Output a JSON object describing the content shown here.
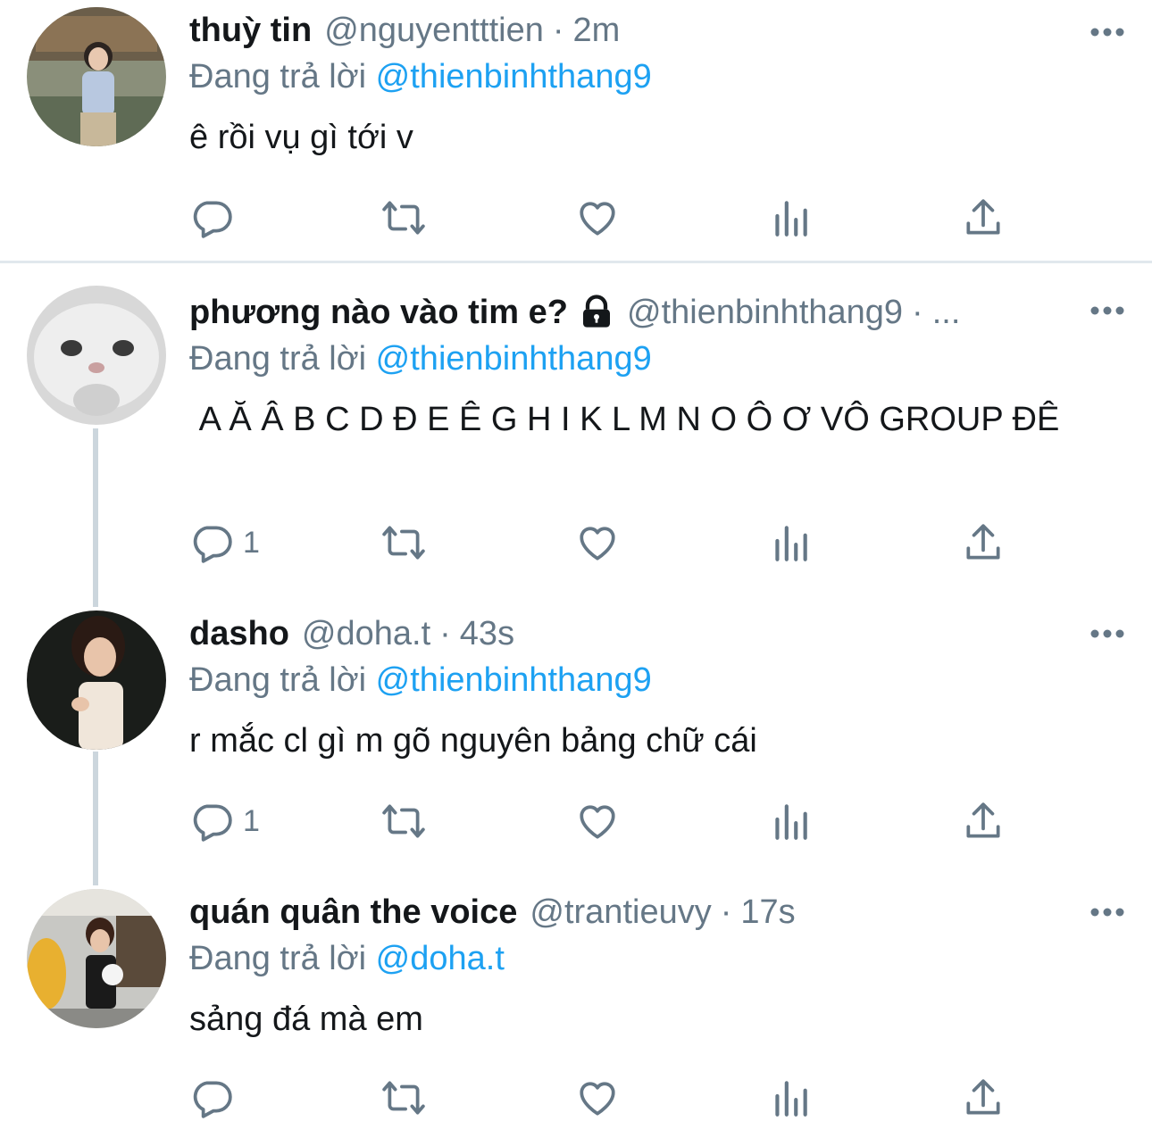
{
  "tweets": [
    {
      "name": "thuỳ tin",
      "handle": "@nguyentttien",
      "separator": "·",
      "time": "2m",
      "reply_prefix": "Đang trả lời",
      "reply_to": "@thienbinhthang9",
      "text": "ê rồi vụ gì tới v",
      "reply_count": "",
      "locked": false
    },
    {
      "name": "phương nào vào tim e?",
      "handle": "@thienbinhthang9",
      "separator": "·",
      "time": "...",
      "reply_prefix": "Đang trả lời",
      "reply_to": "@thienbinhthang9",
      "text": " A Ă Â B C D Đ E Ê G H I K L M N O Ô Ơ VÔ GROUP ĐÊ",
      "reply_count": "1",
      "locked": true
    },
    {
      "name": "dasho",
      "handle": "@doha.t",
      "separator": "·",
      "time": "43s",
      "reply_prefix": "Đang trả lời",
      "reply_to": "@thienbinhthang9",
      "text": "r mắc cl gì m gõ nguyên bảng chữ cái",
      "reply_count": "1",
      "locked": false
    },
    {
      "name": "quán quân the voice",
      "handle": "@trantieuvy",
      "separator": "·",
      "time": "17s",
      "reply_prefix": "Đang trả lời",
      "reply_to": "@doha.t",
      "text": "sảng đá mà em",
      "reply_count": "",
      "locked": false
    }
  ],
  "icons": {
    "reply": "reply-icon",
    "retweet": "retweet-icon",
    "like": "heart-icon",
    "views": "views-icon",
    "share": "share-icon",
    "more": "more-icon",
    "lock": "lock-icon"
  },
  "colors": {
    "text": "#14171a",
    "muted": "#657786",
    "link": "#1da1f2",
    "divider": "#e1e8ed",
    "thread_line": "#ccd6dd"
  }
}
